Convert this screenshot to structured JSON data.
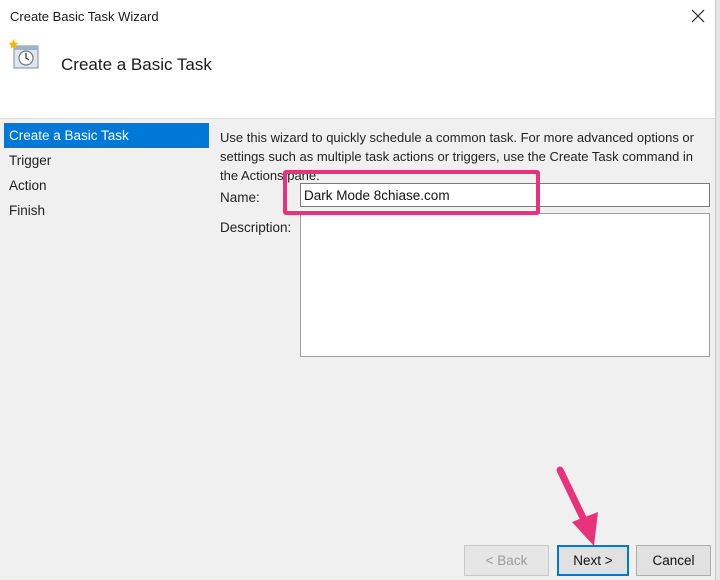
{
  "window": {
    "title": "Create Basic Task Wizard",
    "close_glyph": "✕"
  },
  "header": {
    "title": "Create a Basic Task",
    "icon": "task-clock-icon"
  },
  "sidebar": {
    "items": [
      {
        "label": "Create a Basic Task",
        "active": true
      },
      {
        "label": "Trigger",
        "active": false
      },
      {
        "label": "Action",
        "active": false
      },
      {
        "label": "Finish",
        "active": false
      }
    ]
  },
  "main": {
    "intro": "Use this wizard to quickly schedule a common task.  For more advanced options or settings such as multiple task actions or triggers, use the Create Task command in the Actions pane.",
    "name_label": "Name:",
    "name_value": "Dark Mode 8chiase.com",
    "description_label": "Description:",
    "description_value": ""
  },
  "buttons": {
    "back": "< Back",
    "next": "Next >",
    "cancel": "Cancel"
  },
  "colors": {
    "accent": "#0078d7",
    "annotation": "#e8337a"
  }
}
